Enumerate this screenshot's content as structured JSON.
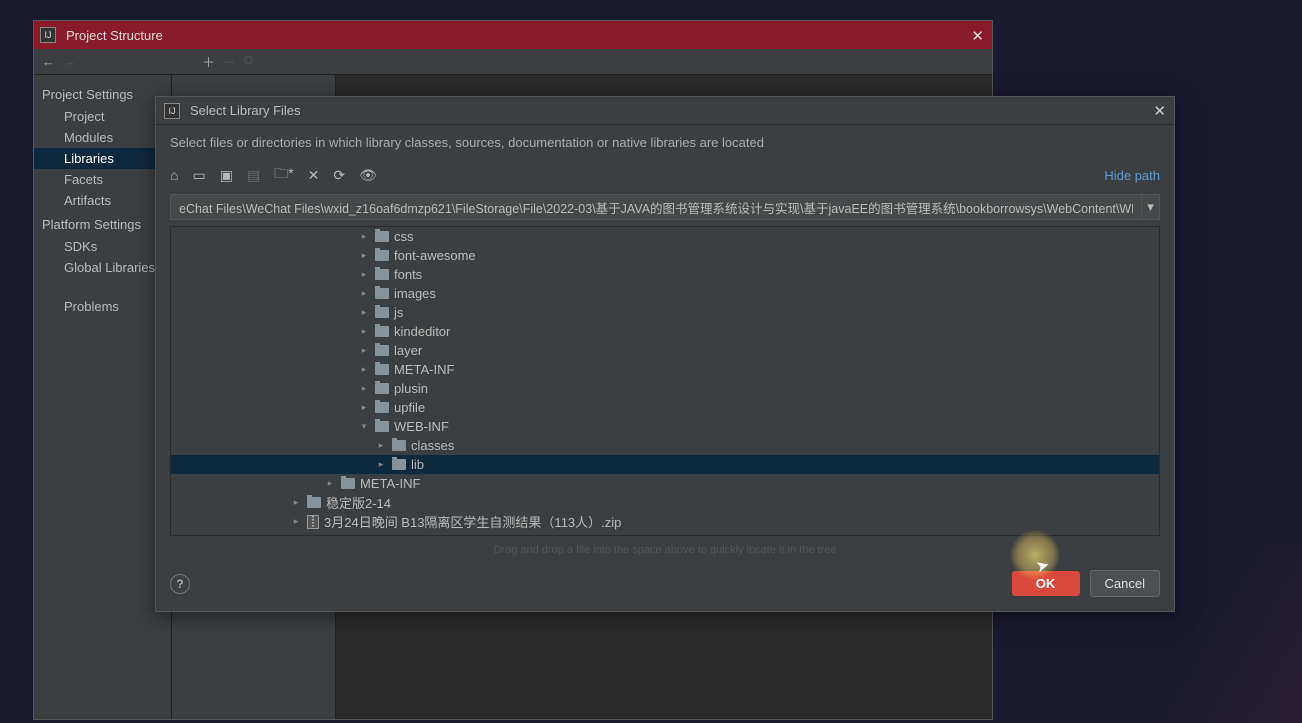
{
  "outer": {
    "title": "Project Structure",
    "sidebar": {
      "project_settings_label": "Project Settings",
      "items_project": [
        {
          "label": "Project"
        },
        {
          "label": "Modules"
        },
        {
          "label": "Libraries",
          "selected": true
        },
        {
          "label": "Facets"
        },
        {
          "label": "Artifacts"
        }
      ],
      "platform_settings_label": "Platform Settings",
      "items_platform": [
        {
          "label": "SDKs"
        },
        {
          "label": "Global Libraries"
        }
      ],
      "problems_label": "Problems"
    }
  },
  "inner": {
    "title": "Select Library Files",
    "hint": "Select files or directories in which library classes, sources, documentation or native libraries are located",
    "hide_path": "Hide path",
    "path_value": "eChat Files\\WeChat Files\\wxid_z16oaf6dmzp621\\FileStorage\\File\\2022-03\\基于JAVA的图书管理系统设计与实现\\基于javaEE的图书管理系统\\bookborrowsys\\WebContent\\WEB-INF\\lib",
    "tree": [
      {
        "indent": 11,
        "expander": "›",
        "type": "folder",
        "label": "css"
      },
      {
        "indent": 11,
        "expander": "›",
        "type": "folder",
        "label": "font-awesome"
      },
      {
        "indent": 11,
        "expander": "›",
        "type": "folder",
        "label": "fonts"
      },
      {
        "indent": 11,
        "expander": "›",
        "type": "folder",
        "label": "images"
      },
      {
        "indent": 11,
        "expander": "›",
        "type": "folder",
        "label": "js"
      },
      {
        "indent": 11,
        "expander": "›",
        "type": "folder",
        "label": "kindeditor"
      },
      {
        "indent": 11,
        "expander": "›",
        "type": "folder",
        "label": "layer"
      },
      {
        "indent": 11,
        "expander": "›",
        "type": "folder",
        "label": "META-INF"
      },
      {
        "indent": 11,
        "expander": "›",
        "type": "folder",
        "label": "plusin"
      },
      {
        "indent": 11,
        "expander": "›",
        "type": "folder",
        "label": "upfile"
      },
      {
        "indent": 11,
        "expander": "⌄",
        "type": "folder",
        "label": "WEB-INF"
      },
      {
        "indent": 12,
        "expander": "›",
        "type": "folder",
        "label": "classes"
      },
      {
        "indent": 12,
        "expander": "›",
        "type": "folder",
        "label": "lib",
        "highlight": true
      },
      {
        "indent": 9,
        "expander": "›",
        "type": "folder",
        "label": "META-INF"
      },
      {
        "indent": 7,
        "expander": "›",
        "type": "folder",
        "label": "稳定版2-14"
      },
      {
        "indent": 7,
        "expander": "›",
        "type": "zip",
        "label": "3月24日晚间 B13隔离区学生自测结果（113人）.zip"
      }
    ],
    "drag_hint": "Drag and drop a file into the space above to quickly locate it in the tree",
    "ok_label": "OK",
    "cancel_label": "Cancel"
  }
}
